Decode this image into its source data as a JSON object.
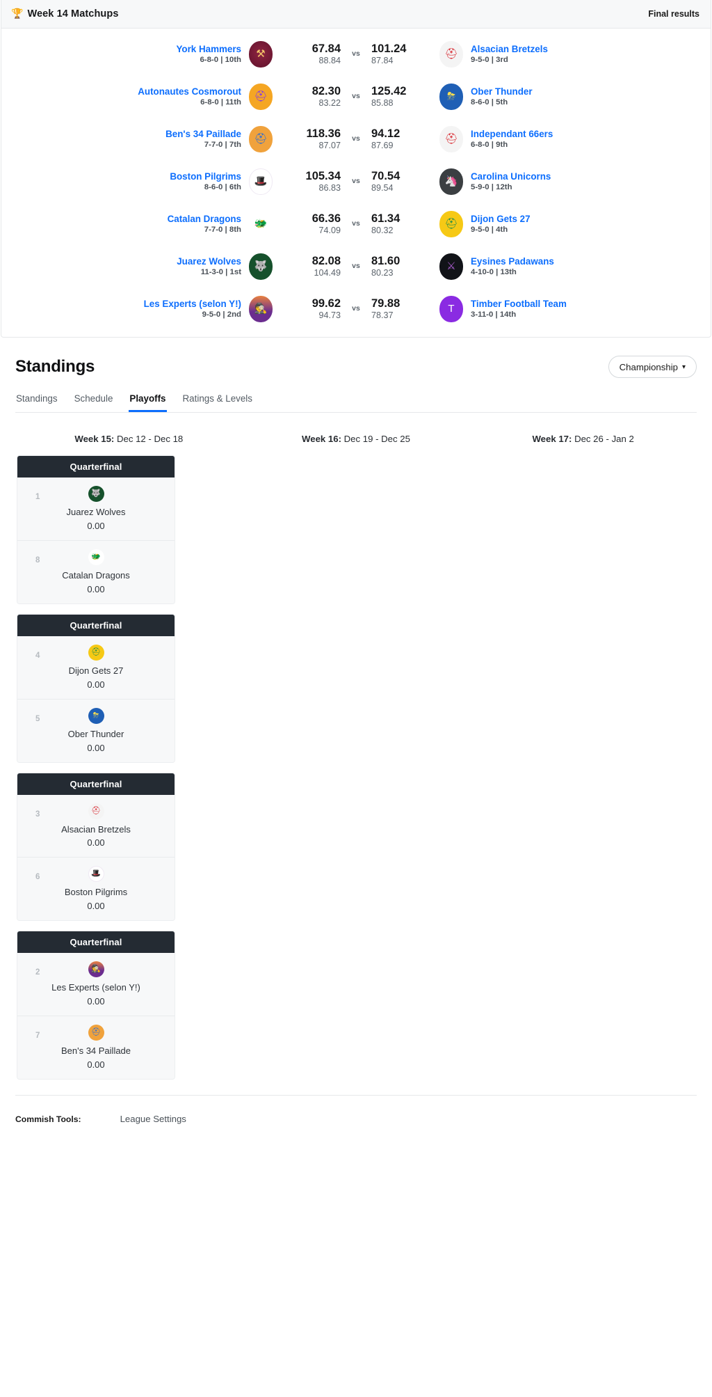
{
  "matchups": {
    "header": {
      "icon": "trophy-icon",
      "title": "Week 14 Matchups",
      "status": "Final results"
    },
    "vs_label": "vs",
    "rows": [
      {
        "left": {
          "name": "York Hammers",
          "record": "6-8-0 | 10th",
          "score": "67.84",
          "projection": "88.84",
          "avatar": "a-hammers",
          "glyph": "⚒"
        },
        "right": {
          "name": "Alsacian Bretzels",
          "record": "9-5-0 | 3rd",
          "score": "101.24",
          "projection": "87.84",
          "avatar": "a-alsacian",
          "glyph": "⛑"
        }
      },
      {
        "left": {
          "name": "Autonautes Cosmorout",
          "record": "6-8-0 | 11th",
          "score": "82.30",
          "projection": "83.22",
          "avatar": "a-cosmo",
          "glyph": "⛑"
        },
        "right": {
          "name": "Ober Thunder",
          "record": "8-6-0 | 5th",
          "score": "125.42",
          "projection": "85.88",
          "avatar": "a-ober",
          "glyph": "⛈"
        }
      },
      {
        "left": {
          "name": "Ben's 34 Paillade",
          "record": "7-7-0 | 7th",
          "score": "118.36",
          "projection": "87.07",
          "avatar": "a-bens",
          "glyph": "⛑"
        },
        "right": {
          "name": "Independant 66ers",
          "record": "6-8-0 | 9th",
          "score": "94.12",
          "projection": "87.69",
          "avatar": "a-indep",
          "glyph": "⛑"
        }
      },
      {
        "left": {
          "name": "Boston Pilgrims",
          "record": "8-6-0 | 6th",
          "score": "105.34",
          "projection": "86.83",
          "avatar": "a-boston",
          "glyph": "🎩"
        },
        "right": {
          "name": "Carolina Unicorns",
          "record": "5-9-0 | 12th",
          "score": "70.54",
          "projection": "89.54",
          "avatar": "a-carolina",
          "glyph": "🦄"
        }
      },
      {
        "left": {
          "name": "Catalan Dragons",
          "record": "7-7-0 | 8th",
          "score": "66.36",
          "projection": "74.09",
          "avatar": "a-catalan",
          "glyph": "🐲"
        },
        "right": {
          "name": "Dijon Gets 27",
          "record": "9-5-0 | 4th",
          "score": "61.34",
          "projection": "80.32",
          "avatar": "a-dijon",
          "glyph": "⛑"
        }
      },
      {
        "left": {
          "name": "Juarez Wolves",
          "record": "11-3-0 | 1st",
          "score": "82.08",
          "projection": "104.49",
          "avatar": "a-juarez",
          "glyph": "🐺"
        },
        "right": {
          "name": "Eysines Padawans",
          "record": "4-10-0 | 13th",
          "score": "81.60",
          "projection": "80.23",
          "avatar": "a-eysines",
          "glyph": "⚔"
        }
      },
      {
        "left": {
          "name": "Les Experts (selon Y!)",
          "record": "9-5-0 | 2nd",
          "score": "99.62",
          "projection": "94.73",
          "avatar": "a-experts",
          "glyph": "🕵"
        },
        "right": {
          "name": "Timber Football Team",
          "record": "3-11-0 | 14th",
          "score": "79.88",
          "projection": "78.37",
          "avatar": "a-timber",
          "glyph": "T"
        }
      }
    ]
  },
  "standings": {
    "title": "Standings",
    "season_selector": "Championship",
    "caret": "⌄",
    "tabs": [
      {
        "label": "Standings",
        "active": false
      },
      {
        "label": "Schedule",
        "active": false
      },
      {
        "label": "Playoffs",
        "active": true
      },
      {
        "label": "Ratings & Levels",
        "active": false
      }
    ]
  },
  "bracket": {
    "weeks": [
      {
        "label": "Week 15:",
        "dates": " Dec 12 - Dec 18"
      },
      {
        "label": "Week 16:",
        "dates": " Dec 19 - Dec 25"
      },
      {
        "label": "Week 17:",
        "dates": " Dec 26 - Jan 2"
      }
    ],
    "round_title": "Quarterfinal",
    "matches": [
      {
        "title": "Quarterfinal",
        "teams": [
          {
            "seed": "1",
            "name": "Juarez Wolves",
            "score": "0.00",
            "avatar": "a-juarez",
            "glyph": "🐺"
          },
          {
            "seed": "8",
            "name": "Catalan Dragons",
            "score": "0.00",
            "avatar": "a-catalan",
            "glyph": "🐲"
          }
        ]
      },
      {
        "title": "Quarterfinal",
        "teams": [
          {
            "seed": "4",
            "name": "Dijon Gets 27",
            "score": "0.00",
            "avatar": "a-dijon",
            "glyph": "⛑"
          },
          {
            "seed": "5",
            "name": "Ober Thunder",
            "score": "0.00",
            "avatar": "a-ober",
            "glyph": "⛈"
          }
        ]
      },
      {
        "title": "Quarterfinal",
        "teams": [
          {
            "seed": "3",
            "name": "Alsacian Bretzels",
            "score": "0.00",
            "avatar": "a-alsacian",
            "glyph": "⛑"
          },
          {
            "seed": "6",
            "name": "Boston Pilgrims",
            "score": "0.00",
            "avatar": "a-boston",
            "glyph": "🎩"
          }
        ]
      },
      {
        "title": "Quarterfinal",
        "teams": [
          {
            "seed": "2",
            "name": "Les Experts (selon Y!)",
            "score": "0.00",
            "avatar": "a-experts",
            "glyph": "🕵"
          },
          {
            "seed": "7",
            "name": "Ben's 34 Paillade",
            "score": "0.00",
            "avatar": "a-bens",
            "glyph": "⛑"
          }
        ]
      }
    ]
  },
  "footer": {
    "label": "Commish Tools:",
    "link": "League Settings"
  }
}
